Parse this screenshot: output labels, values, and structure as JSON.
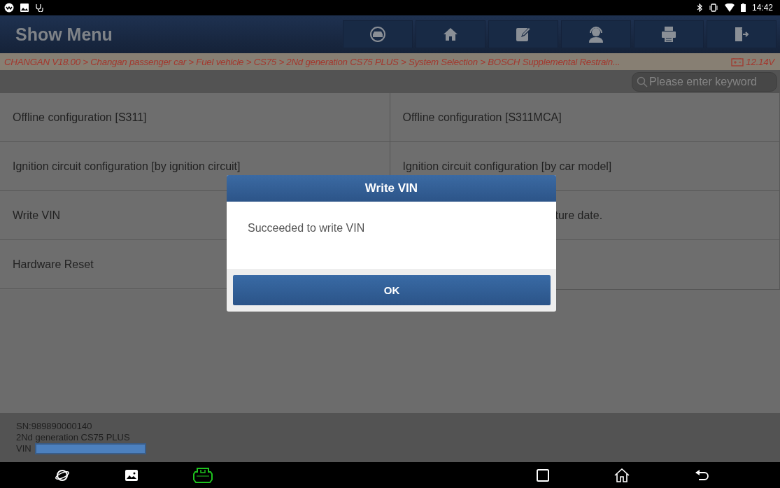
{
  "status_bar": {
    "time": "14:42"
  },
  "header": {
    "title": "Show Menu",
    "toolbar": [
      {
        "kind": "car"
      },
      {
        "kind": "home"
      },
      {
        "kind": "edit"
      },
      {
        "kind": "support"
      },
      {
        "kind": "print"
      },
      {
        "kind": "exit"
      }
    ]
  },
  "breadcrumb": {
    "path": "CHANGAN V18.00 > Changan passenger car > Fuel vehicle > CS75 > 2Nd generation CS75 PLUS > System Selection > BOSCH Supplemental Restrain...",
    "voltage": "12.14V"
  },
  "search": {
    "placeholder": "Please enter keyword"
  },
  "menu_items": [
    {
      "label": "Offline configuration [S311]",
      "covered": false
    },
    {
      "label": "Offline configuration [S311MCA]",
      "covered": false
    },
    {
      "label": "Ignition circuit configuration [by ignition circuit]",
      "covered": false
    },
    {
      "label": "Ignition circuit configuration [by car model]",
      "covered": false
    },
    {
      "label": "Write VIN",
      "covered": false
    },
    {
      "label": "ture date.",
      "covered": true
    },
    {
      "label": "Hardware Reset",
      "covered": false
    }
  ],
  "vehicle_info": {
    "serial": "SN:989890000140",
    "model": "2Nd generation CS75 PLUS",
    "vin_label": "VIN"
  },
  "dialog": {
    "title": "Write VIN",
    "message": "Succeeded to write VIN",
    "button": "OK"
  }
}
